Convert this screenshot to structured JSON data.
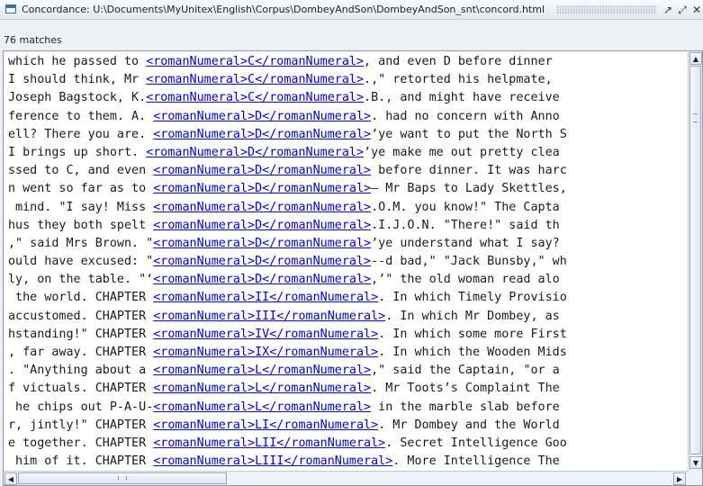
{
  "window": {
    "title": "Concordance: U:\\Documents\\MyUnitex\\English\\Corpus\\DombeyAndSon\\DombeyAndSon_snt\\concord.html",
    "icon": "window-icon",
    "controls": [
      "restore-icon",
      "maximize-icon",
      "close-icon"
    ]
  },
  "status": {
    "matches": "76 matches"
  },
  "colors": {
    "link": "#0000ee",
    "text": "#1a1a1a"
  },
  "lines": [
    {
      "left": "which he passed to ",
      "match": "<romanNumeral>C</romanNumeral>",
      "right": ", and even D before dinner"
    },
    {
      "left": "I should think, Mr ",
      "match": "<romanNumeral>C</romanNumeral>",
      "right": ".,\" retorted his helpmate,"
    },
    {
      "left": "Joseph Bagstock, K.",
      "match": "<romanNumeral>C</romanNumeral>",
      "right": ".B., and might have receive"
    },
    {
      "left": "ference to them. A. ",
      "match": "<romanNumeral>D</romanNumeral>",
      "right": ". had no concern with Anno"
    },
    {
      "left": "ell? There you are. ",
      "match": "<romanNumeral>D</romanNumeral>",
      "right": "’ye want to put the North S"
    },
    {
      "left": "I brings up short. ",
      "match": "<romanNumeral>D</romanNumeral>",
      "right": "’ye make me out pretty clea"
    },
    {
      "left": "ssed to C, and even ",
      "match": "<romanNumeral>D</romanNumeral>",
      "right": " before dinner. It was harc"
    },
    {
      "left": "n went so far as to ",
      "match": "<romanNumeral>D</romanNumeral>",
      "right": "– Mr Baps to Lady Skettles,"
    },
    {
      "left": " mind. \"I say! Miss ",
      "match": "<romanNumeral>D</romanNumeral>",
      "right": ".O.M. you know!\" The Capta"
    },
    {
      "left": "hus they both spelt ",
      "match": "<romanNumeral>D</romanNumeral>",
      "right": ".I.J.O.N. \"There!\" said th"
    },
    {
      "left": ",\" said Mrs Brown. \"",
      "match": "<romanNumeral>D</romanNumeral>",
      "right": "’ye understand what I say?"
    },
    {
      "left": "ould have excused: \"",
      "match": "<romanNumeral>D</romanNumeral>",
      "right": "--d bad,\" \"Jack Bunsby,\" wh"
    },
    {
      "left": "ly, on the table. \"‘",
      "match": "<romanNumeral>D</romanNumeral>",
      "right": ",’\" the old woman read alo"
    },
    {
      "left": " the world. CHAPTER ",
      "match": "<romanNumeral>II</romanNumeral>",
      "right": ". In which Timely Provisio"
    },
    {
      "left": "accustomed. CHAPTER ",
      "match": "<romanNumeral>III</romanNumeral>",
      "right": ". In which Mr Dombey, as"
    },
    {
      "left": "hstanding!\" CHAPTER ",
      "match": "<romanNumeral>IV</romanNumeral>",
      "right": ". In which some more First"
    },
    {
      "left": ", far away. CHAPTER ",
      "match": "<romanNumeral>IX</romanNumeral>",
      "right": ". In which the Wooden Mids"
    },
    {
      "left": ". \"Anything about a ",
      "match": "<romanNumeral>L</romanNumeral>",
      "right": ",\" said the Captain, \"or a"
    },
    {
      "left": "f victuals. CHAPTER ",
      "match": "<romanNumeral>L</romanNumeral>",
      "right": ". Mr Toots’s Complaint The"
    },
    {
      "left": " he chips out P-A-U-",
      "match": "<romanNumeral>L</romanNumeral>",
      "right": " in the marble slab before"
    },
    {
      "left": "r, jintly!\" CHAPTER ",
      "match": "<romanNumeral>LI</romanNumeral>",
      "right": ". Mr Dombey and the World"
    },
    {
      "left": "e together. CHAPTER ",
      "match": "<romanNumeral>LII</romanNumeral>",
      "right": ". Secret Intelligence Goo"
    },
    {
      "left": " him of it. CHAPTER ",
      "match": "<romanNumeral>LIII</romanNumeral>",
      "right": ". More Intelligence The"
    }
  ]
}
